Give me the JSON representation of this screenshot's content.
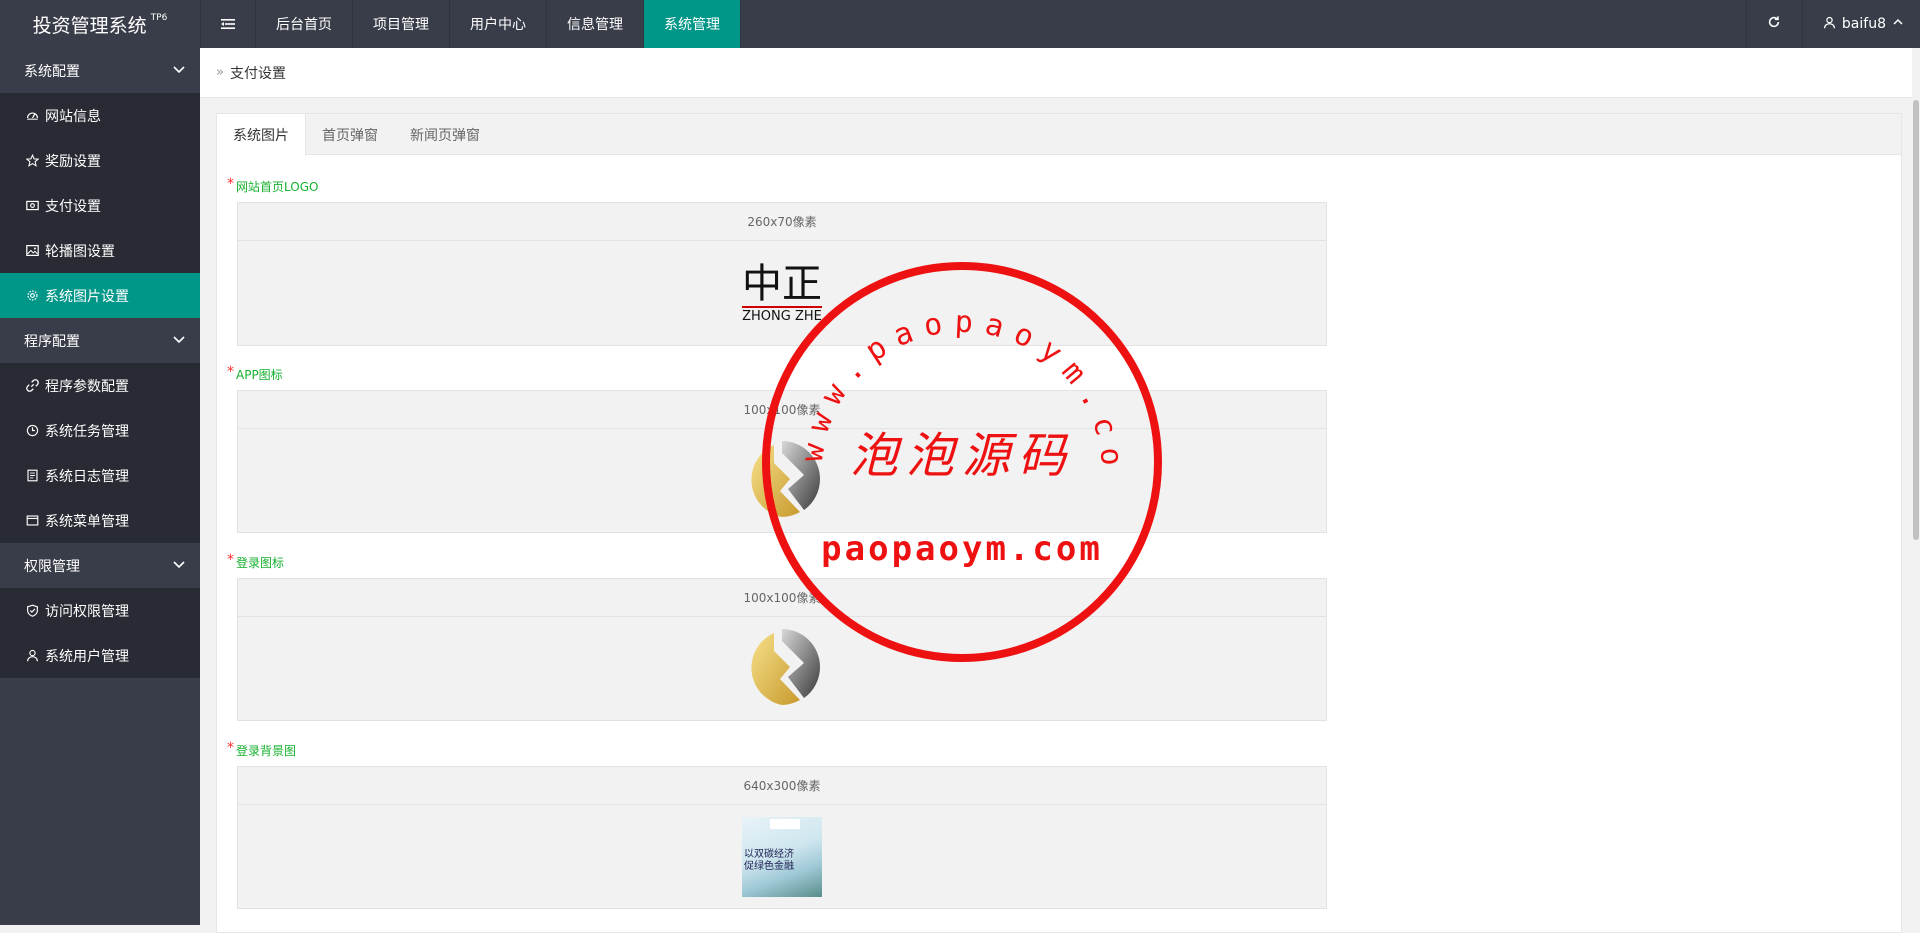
{
  "header": {
    "app_title": "投资管理系统",
    "app_badge": "TP6",
    "nav": [
      {
        "label": "后台首页"
      },
      {
        "label": "项目管理"
      },
      {
        "label": "用户中心"
      },
      {
        "label": "信息管理"
      },
      {
        "label": "系统管理"
      }
    ],
    "active_nav": "系统管理",
    "username": "baifu8"
  },
  "sidebar": {
    "groups": [
      {
        "label": "系统配置",
        "items": [
          {
            "label": "网站信息",
            "icon": "dashboard-icon"
          },
          {
            "label": "奖励设置",
            "icon": "star-icon"
          },
          {
            "label": "支付设置",
            "icon": "money-icon"
          },
          {
            "label": "轮播图设置",
            "icon": "image-icon"
          },
          {
            "label": "系统图片设置",
            "icon": "gear-icon"
          }
        ]
      },
      {
        "label": "程序配置",
        "items": [
          {
            "label": "程序参数配置",
            "icon": "link-icon"
          },
          {
            "label": "系统任务管理",
            "icon": "clock-icon"
          },
          {
            "label": "系统日志管理",
            "icon": "file-icon"
          },
          {
            "label": "系统菜单管理",
            "icon": "window-icon"
          }
        ]
      },
      {
        "label": "权限管理",
        "items": [
          {
            "label": "访问权限管理",
            "icon": "shield-icon"
          },
          {
            "label": "系统用户管理",
            "icon": "user-icon"
          }
        ]
      }
    ],
    "active_item": "系统图片设置"
  },
  "breadcrumb": {
    "current": "支付设置"
  },
  "tabs": [
    {
      "label": "系统图片"
    },
    {
      "label": "首页弹窗"
    },
    {
      "label": "新闻页弹窗"
    }
  ],
  "fields": [
    {
      "label": "网站首页LOGO",
      "size_hint": "260x70像素",
      "logo_cn": "中正",
      "logo_en": "ZHONG ZHE"
    },
    {
      "label": "APP图标",
      "size_hint": "100x100像素"
    },
    {
      "label": "登录图标",
      "size_hint": "100x100像素"
    },
    {
      "label": "登录背景图",
      "size_hint": "640x300像素",
      "thumb_text": "以双碳经济\n促绿色金融"
    }
  ],
  "watermark": {
    "arc_text": "www.paopaoym.com",
    "center_text": "泡泡源码",
    "bottom_text": "paopaoym.com",
    "color": "#ee1111"
  },
  "colors": {
    "accent": "#009688",
    "dark": "#393d49",
    "darker": "#282b33",
    "label_green": "#16b12f",
    "required_red": "#ff2d2d"
  }
}
